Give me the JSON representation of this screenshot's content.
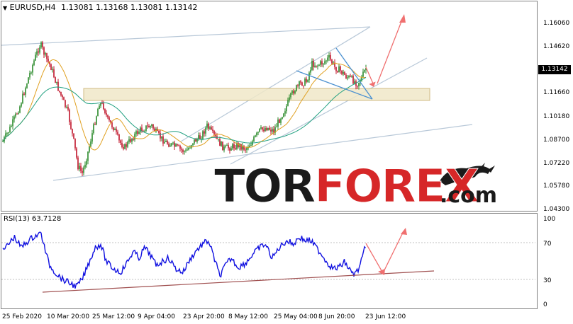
{
  "header": {
    "symbol_label": "EURUSD,H4",
    "ohlc": "1.13081 1.13168 1.13081 1.13142"
  },
  "price_axis": {
    "labels": [
      "1.16060",
      "1.14620",
      "1.13142",
      "1.11660",
      "1.10180",
      "1.08700",
      "1.07220",
      "1.05780",
      "1.04300"
    ]
  },
  "current_price": "1.13142",
  "rsi": {
    "label": "RSI(13) 63.7128",
    "levels": [
      "100",
      "70",
      "30",
      "0"
    ]
  },
  "time_axis": {
    "labels": [
      "25 Feb 2020",
      "10 Mar 20:00",
      "25 Mar 12:00",
      "9 Apr 04:00",
      "23 Apr 20:00",
      "8 May 12:00",
      "25 May 04:00",
      "8 Jun 20:00",
      "23 Jun 12:00"
    ]
  },
  "watermark": {
    "part1": "TOR",
    "part2": "FOREX",
    "suffix": ".com"
  },
  "colors": {
    "bull": "#2a8a2a",
    "bear": "#c0142a",
    "ma_fast": "#e0a020",
    "ma_slow": "#20a080",
    "channel": "#b8c8d8",
    "zone_fill": "#f0e8c8",
    "arrow": "#f07070",
    "rsi_line": "#1010e0",
    "rsi_trend": "#a05050"
  },
  "icons": {
    "header": "dropdown-arrow-icon",
    "logo": "bull-bear-icon"
  }
}
